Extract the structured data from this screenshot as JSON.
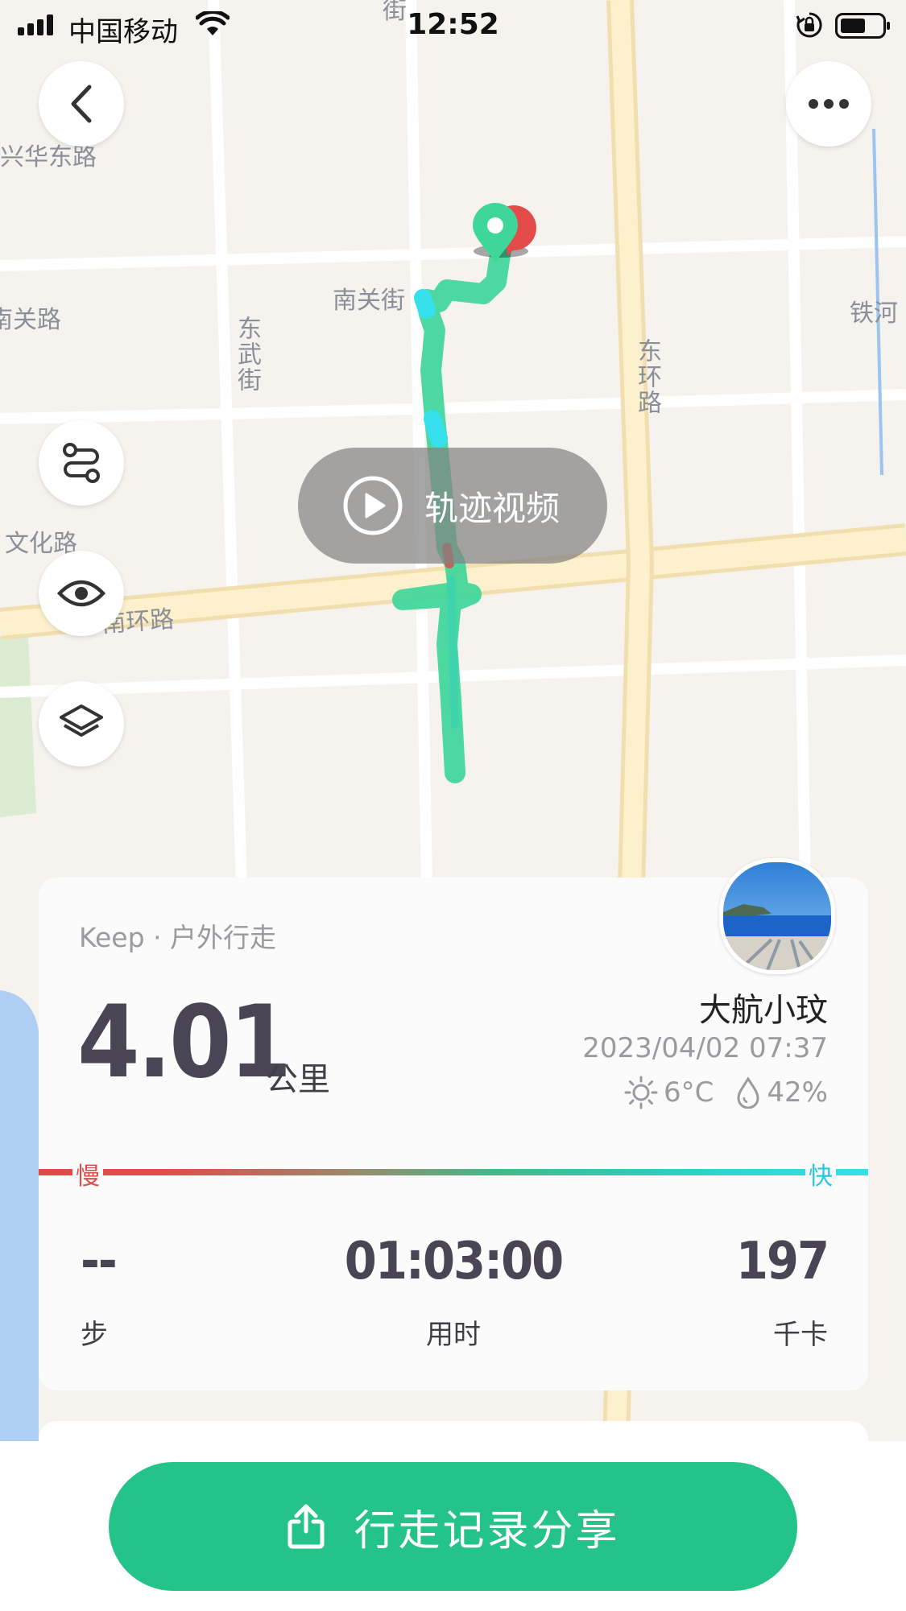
{
  "status_bar": {
    "carrier": "中国移动",
    "time": "12:52"
  },
  "map": {
    "labels": [
      "兴华东路",
      "南关街",
      "南关路",
      "东武街",
      "东环路",
      "铁河",
      "文化路",
      "南环路",
      "街"
    ],
    "video_label": "轨迹视频"
  },
  "summary": {
    "source": "Keep · 户外行走",
    "distance": "4.01",
    "distance_unit": "公里",
    "user_name": "大航小玟",
    "datetime": "2023/04/02 07:37",
    "temperature": "6°C",
    "humidity": "42%",
    "pace_slow": "慢",
    "pace_fast": "快",
    "stats": [
      {
        "value": "--",
        "label": "步"
      },
      {
        "value": "01:03:00",
        "label": "用时"
      },
      {
        "value": "197",
        "label": "千卡"
      }
    ]
  },
  "share_button": "行走记录分享",
  "colors": {
    "accent": "#24c389",
    "track": "#3fd69a",
    "slow": "#e34b4b",
    "fast": "#35e0ec"
  }
}
